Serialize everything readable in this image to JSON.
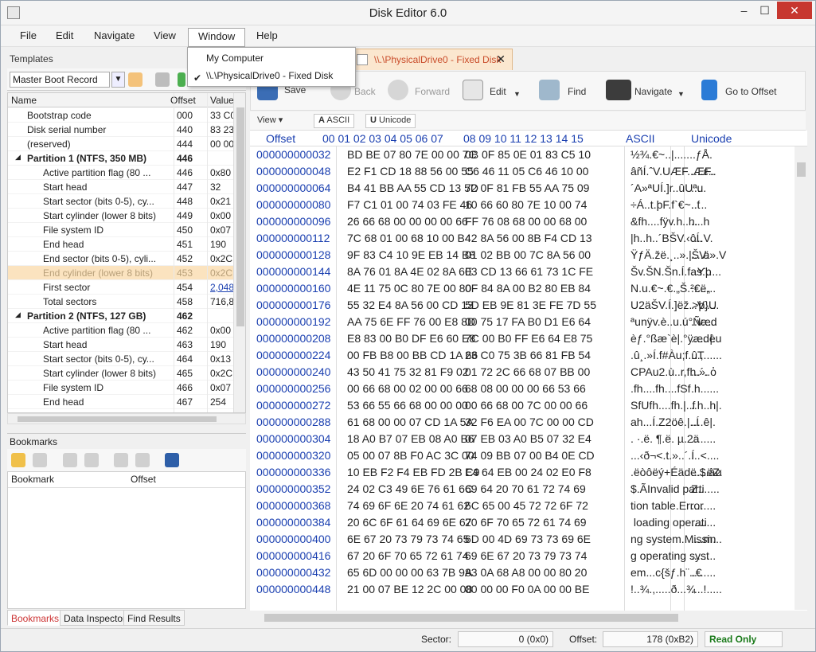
{
  "window": {
    "title": "Disk Editor 6.0",
    "min": "‒",
    "max": "☐",
    "close": "✕"
  },
  "menu": [
    "File",
    "Edit",
    "Navigate",
    "View",
    "Window",
    "Help"
  ],
  "window_menu": {
    "items": [
      "My Computer",
      "\\\\.\\PhysicalDrive0 - Fixed Disk"
    ],
    "checked_mark": "✔"
  },
  "templates": {
    "header": "Templates",
    "selected": "Master Boot Record",
    "columns": [
      "Name",
      "Offset",
      "Value"
    ],
    "rows": [
      {
        "name": "Bootstrap code",
        "offset": "000",
        "value": "33 C0",
        "kind": "item"
      },
      {
        "name": "Disk serial number",
        "offset": "440",
        "value": "83 23",
        "kind": "item"
      },
      {
        "name": "(reserved)",
        "offset": "444",
        "value": "00 00",
        "kind": "item"
      },
      {
        "name": "Partition 1 (NTFS, 350 MB)",
        "offset": "446",
        "value": "",
        "kind": "group"
      },
      {
        "name": "Active partition flag (80 ...",
        "offset": "446",
        "value": "0x80",
        "kind": "sub"
      },
      {
        "name": "Start head",
        "offset": "447",
        "value": "32",
        "kind": "sub"
      },
      {
        "name": "Start sector (bits 0-5), cy...",
        "offset": "448",
        "value": "0x21",
        "kind": "sub"
      },
      {
        "name": "Start cylinder (lower 8 bits)",
        "offset": "449",
        "value": "0x00",
        "kind": "sub"
      },
      {
        "name": "File system ID",
        "offset": "450",
        "value": "0x07",
        "kind": "sub"
      },
      {
        "name": "End head",
        "offset": "451",
        "value": "190",
        "kind": "sub"
      },
      {
        "name": "End sector (bits 0-5), cyli...",
        "offset": "452",
        "value": "0x2C",
        "kind": "sub"
      },
      {
        "name": "End cylinder (lower 8 bits)",
        "offset": "453",
        "value": "0x2C",
        "kind": "sub-hl"
      },
      {
        "name": "First sector",
        "offset": "454",
        "value": "2,048",
        "kind": "sub-link"
      },
      {
        "name": "Total sectors",
        "offset": "458",
        "value": "716,8",
        "kind": "sub"
      },
      {
        "name": "Partition 2 (NTFS, 127 GB)",
        "offset": "462",
        "value": "",
        "kind": "group"
      },
      {
        "name": "Active partition flag (80 ...",
        "offset": "462",
        "value": "0x00",
        "kind": "sub"
      },
      {
        "name": "Start head",
        "offset": "463",
        "value": "190",
        "kind": "sub"
      },
      {
        "name": "Start sector (bits 0-5), cy...",
        "offset": "464",
        "value": "0x13",
        "kind": "sub"
      },
      {
        "name": "Start cylinder (lower 8 bits)",
        "offset": "465",
        "value": "0x2C",
        "kind": "sub"
      },
      {
        "name": "File system ID",
        "offset": "466",
        "value": "0x07",
        "kind": "sub"
      },
      {
        "name": "End head",
        "offset": "467",
        "value": "254",
        "kind": "sub"
      },
      {
        "name": "End sector (bits 0-5), cyli...",
        "offset": "468",
        "value": "0x00",
        "kind": "sub"
      }
    ]
  },
  "bookmarks": {
    "header": "Bookmarks",
    "columns": [
      "Bookmark",
      "Offset"
    ]
  },
  "left_tabs": [
    "Bookmarks",
    "Data Inspector",
    "Find Results"
  ],
  "document_tab": {
    "title": "\\\\.\\PhysicalDrive0 - Fixed Disk",
    "close": "✕"
  },
  "toolbar": {
    "save": "Save",
    "back": "Back",
    "forward": "Forward",
    "edit": "Edit",
    "find": "Find",
    "navigate": "Navigate",
    "goto": "Go to Offset"
  },
  "view_toolbar": {
    "view": "View",
    "ascii": "ASCII",
    "unicode": "Unicode"
  },
  "hex": {
    "header": {
      "offset": "Offset",
      "cols1": "00 01 02 03 04 05 06 07",
      "cols2": "08 09 10 11 12 13 14 15",
      "ascii": "ASCII",
      "unicode": "Unicode"
    },
    "rows": [
      {
        "offset": "000000000032",
        "h1": "BD BE 07 80 7E 00 00 7C",
        "h2": "0B 0F 85 0E 01 83 C5 10",
        "ascii": "½¾.€~..|.......ƒÅ.",
        "unicode": ""
      },
      {
        "offset": "000000000048",
        "h1": "E2 F1 CD 18 88 56 00 55",
        "h2": "C6 46 11 05 C6 46 10 00",
        "ascii": "âñÍ.ˆV.UÆF..ÆF..",
        "unicode": "....ε.."
      },
      {
        "offset": "000000000064",
        "h1": "B4 41 BB AA 55 CD 13 5D",
        "h2": "72 0F 81 FB 55 AA 75 09",
        "ascii": "´A»ªUÍ.]r..ûUªu.",
        "unicode": "...."
      },
      {
        "offset": "000000000080",
        "h1": "F7 C1 01 00 74 03 FE 46",
        "h2": "10 66 60 80 7E 10 00 74",
        "ascii": "÷Á..t.þF.f`€~..t",
        "unicode": "..´.."
      },
      {
        "offset": "000000000096",
        "h1": "26 66 68 00 00 00 00 66",
        "h2": "FF 76 08 68 00 00 68 00",
        "ascii": "&fh....fÿv.h..h.",
        "unicode": "....h"
      },
      {
        "offset": "000000000112",
        "h1": "7C 68 01 00 68 10 00 B4",
        "h2": "42 8A 56 00 8B F4 CD 13",
        "ascii": "|h..h..´BŠV.‹ôÍ.",
        "unicode": "....V."
      },
      {
        "offset": "000000000128",
        "h1": "9F 83 C4 10 9E EB 14 B8",
        "h2": "01 02 BB 00 7C 8A 56 00",
        "ascii": "ŸƒÄ.žë.¸..».|ŠV.",
        "unicode": "....ä».V"
      },
      {
        "offset": "000000000144",
        "h1": "8A 76 01 8A 4E 02 8A 6E",
        "h2": "03 CD 13 66 61 73 1C FE",
        "ascii": "Šv.ŠN.Šn.Í.fas.þ",
        "unicode": "..Ƴ....."
      },
      {
        "offset": "000000000160",
        "h1": "4E 11 75 0C 80 7E 00 80",
        "h2": "0F 84 8A 00 B2 80 EB 84",
        "ascii": "N.u.€~.€.„Š.²€ë„",
        "unicode": "........"
      },
      {
        "offset": "000000000176",
        "h1": "55 32 E4 8A 56 00 CD 13",
        "h2": "5D EB 9E 81 3E FE 7D 55",
        "ascii": "U2äŠV.Í.]ëž.>þ}U",
        "unicode": "..V....."
      },
      {
        "offset": "000000000192",
        "h1": "AA 75 6E FF 76 00 E8 8D",
        "h2": "00 75 17 FA B0 D1 E6 64",
        "ascii": "ªunÿv.è..u.ú°Ñæd",
        "unicode": "..v....."
      },
      {
        "offset": "000000000208",
        "h1": "E8 83 00 B0 DF E6 60 E8",
        "h2": "7C 00 B0 FF E6 64 E8 75",
        "ascii": "èƒ.°ßæ`è|.°ÿædèu",
        "unicode": "......|."
      },
      {
        "offset": "000000000224",
        "h1": "00 FB B8 00 BB CD 1A 66",
        "h2": "23 C0 75 3B 66 81 FB 54",
        "ascii": ".û¸.»Í.f#Àu;f.ûT",
        "unicode": "...,......"
      },
      {
        "offset": "000000000240",
        "h1": "43 50 41 75 32 81 F9 02",
        "h2": "01 72 2C 66 68 07 BB 00",
        "ascii": "CPAu2.ù..r,fh.».",
        "unicode": "...´..ὀ"
      },
      {
        "offset": "000000000256",
        "h1": "00 66 68 00 02 00 00 66",
        "h2": "68 08 00 00 00 66 53 66",
        "ascii": ".fh....fh....fSf",
        "unicode": ".h......"
      },
      {
        "offset": "000000000272",
        "h1": "53 66 55 66 68 00 00 00",
        "h2": "00 66 68 00 7C 00 00 66",
        "ascii": "SfUfh....fh.|..f",
        "unicode": "..h..h|."
      },
      {
        "offset": "000000000288",
        "h1": "61 68 00 00 07 CD 1A 5A",
        "h2": "32 F6 EA 00 7C 00 00 CD",
        "ascii": "ah...Í.Z2öê.|..Í",
        "unicode": "....ê|."
      },
      {
        "offset": "000000000304",
        "h1": "18 A0 B7 07 EB 08 A0 B6",
        "h2": "07 EB 03 A0 B5 07 32 E4",
        "ascii": ". ·.ë. ¶.ë. µ.2ä",
        "unicode": "........"
      },
      {
        "offset": "000000000320",
        "h1": "05 00 07 8B F0 AC 3C 00",
        "h2": "74 09 BB 07 00 B4 0E CD",
        "ascii": "...‹ð¬<.t.»..´.Í",
        "unicode": "...<...."
      },
      {
        "offset": "000000000336",
        "h1": "10 EB F2 F4 EB FD 2B C9",
        "h2": "E4 64 EB 00 24 02 E0 F8",
        "ascii": ".ëòôëý+Éädë.$.àø",
        "unicode": ".....ëZ."
      },
      {
        "offset": "000000000352",
        "h1": "24 02 C3 49 6E 76 61 6C",
        "h2": "69 64 20 70 61 72 74 69",
        "ascii": "$.ÃInvalid parti",
        "unicode": "Ζ......."
      },
      {
        "offset": "000000000368",
        "h1": "74 69 6F 6E 20 74 61 62",
        "h2": "6C 65 00 45 72 72 6F 72",
        "ascii": "tion table.Error",
        "unicode": "........"
      },
      {
        "offset": "000000000384",
        "h1": "20 6C 6F 61 64 69 6E 67",
        "h2": "20 6F 70 65 72 61 74 69",
        "ascii": " loading operati",
        "unicode": "........"
      },
      {
        "offset": "000000000400",
        "h1": "6E 67 20 73 79 73 74 65",
        "h2": "6D 00 4D 69 73 73 69 6E",
        "ascii": "ng system.Missin",
        "unicode": "....m..."
      },
      {
        "offset": "000000000416",
        "h1": "67 20 6F 70 65 72 61 74",
        "h2": "69 6E 67 20 73 79 73 74",
        "ascii": "g operating syst",
        "unicode": "........"
      },
      {
        "offset": "000000000432",
        "h1": "65 6D 00 00 00 63 7B 9A",
        "h2": "83 0A 68 A8 00 00 80 20",
        "ascii": "em...c{šƒ.h¨..€ ",
        "unicode": "........"
      },
      {
        "offset": "000000000448",
        "h1": "21 00 07 BE 12 2C 00 08",
        "h2": "00 00 00 F0 0A 00 00 BE",
        "ascii": "!..¾.,.....ð...¾",
        "unicode": "....!....."
      }
    ]
  },
  "status": {
    "sector_label": "Sector:",
    "sector_value": "0 (0x0)",
    "offset_label": "Offset:",
    "offset_value": "178 (0xB2)",
    "mode": "Read Only"
  }
}
